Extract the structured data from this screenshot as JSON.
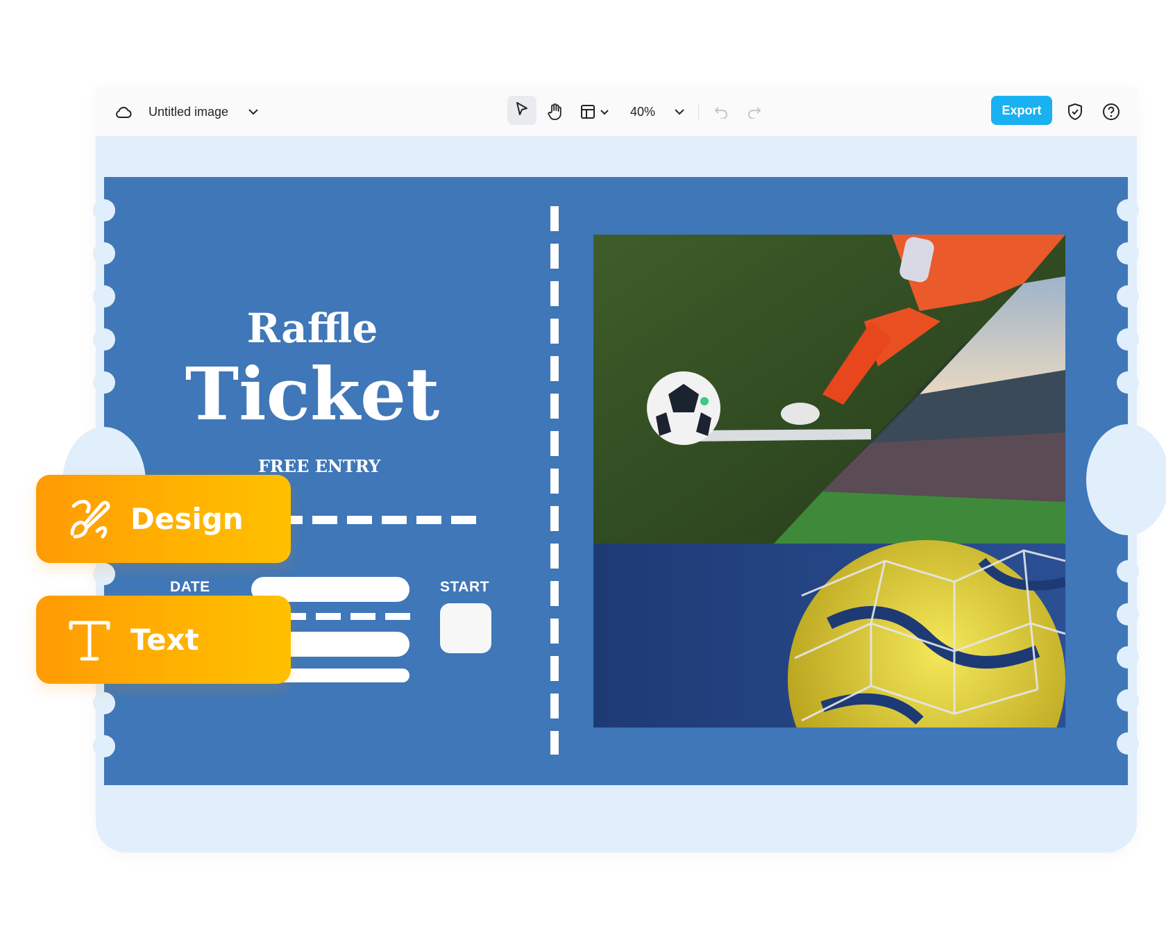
{
  "toolbar": {
    "doc_title": "Untitled image",
    "zoom": "40%",
    "export_label": "Export",
    "icons": [
      "cloud-icon",
      "chevron-down-icon",
      "pointer-icon",
      "hand-icon",
      "layout-icon",
      "undo-icon",
      "redo-icon",
      "shield-check-icon",
      "help-icon"
    ]
  },
  "ticket": {
    "title_line1": "Raffle",
    "title_line2": "Ticket",
    "subtitle": "FREE ENTRY",
    "date_label": "DATE",
    "start_label": "START",
    "background": "#3f77b8"
  },
  "chips": {
    "design_label": "Design",
    "text_label": "Text",
    "gradient": [
      "#ff9a05",
      "#ffc000"
    ]
  },
  "colors": {
    "canvas": "#e1eefb",
    "accent": "#19b1f1"
  }
}
